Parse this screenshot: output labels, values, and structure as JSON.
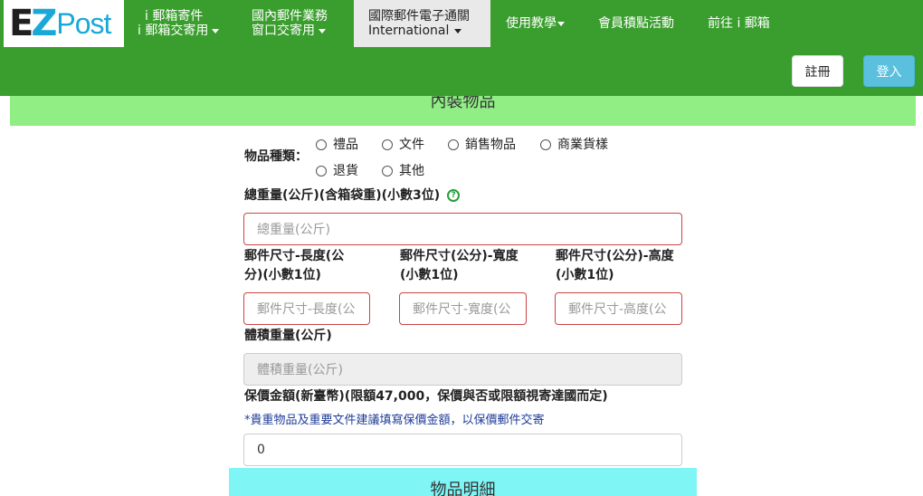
{
  "logo": {
    "ez_e": "E",
    "ez_z": "Z",
    "post": "Post"
  },
  "nav": {
    "mailbox_send": {
      "line1": "i 郵箱寄件",
      "line2": "i 郵箱交寄用"
    },
    "domestic": {
      "line1": "國內郵件業務",
      "line2": "窗口交寄用"
    },
    "international": {
      "line1": "國際郵件電子通關",
      "line2": "International"
    },
    "tutorial": "使用教學",
    "points": "會員積點活動",
    "goto_post": "前往 i 郵箱"
  },
  "auth": {
    "register": "註冊",
    "login": "登入"
  },
  "sections": {
    "inner_items": "內裝物品",
    "item_details": "物品明細"
  },
  "form": {
    "item_type_label": "物品種類：",
    "item_types": [
      "禮品",
      "文件",
      "銷售物品",
      "商業貨樣",
      "退貨",
      "其他"
    ],
    "total_weight": {
      "label": "總重量(公斤)(含箱袋重)(小數3位)",
      "placeholder": "總重量(公斤)"
    },
    "length": {
      "label_line1": "郵件尺寸-長度(公",
      "label_line2": "分)(小數1位)",
      "placeholder": "郵件尺寸-長度(公"
    },
    "width": {
      "label_line1": "郵件尺寸(公分)-寬度",
      "label_line2": "(小數1位)",
      "placeholder": "郵件尺寸-寬度(公"
    },
    "height": {
      "label_line1": "郵件尺寸(公分)-高度",
      "label_line2": "(小數1位)",
      "placeholder": "郵件尺寸-高度(公"
    },
    "volume_weight": {
      "label": "體積重量(公斤)",
      "placeholder": "體積重量(公斤)"
    },
    "insured": {
      "label": "保價金額(新臺幣)(限額47,000，保價與否或限額視寄達國而定)",
      "note": "*貴重物品及重要文件建議填寫保價金額，以保價郵件交寄",
      "value": "0"
    }
  },
  "colors": {
    "navbar": "#3a9e2e",
    "section_inner": "#90ee85",
    "section_detail": "#7ff5f5",
    "login": "#5bc0de",
    "error_border": "#cc4444",
    "note_text": "#1f3c99"
  }
}
